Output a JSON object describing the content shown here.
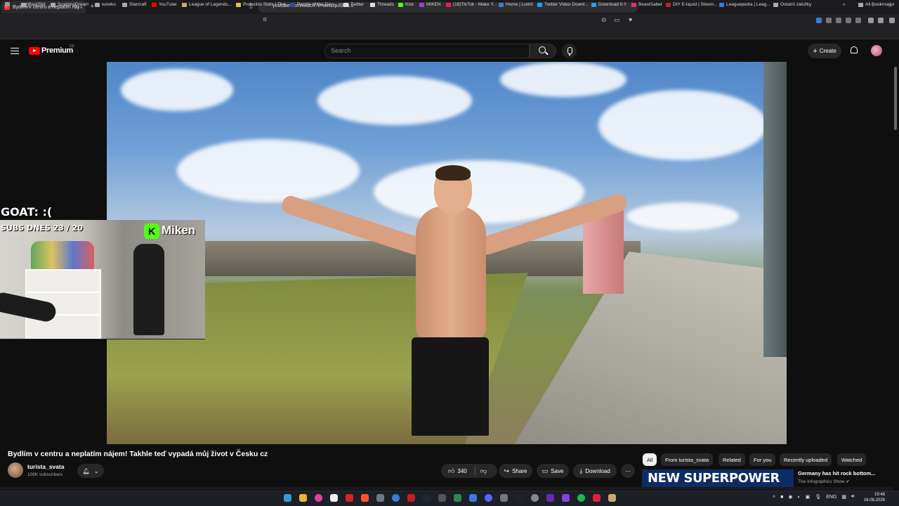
{
  "browser": {
    "tab_title": "Bydlím v centru a neplatím nájem",
    "tab_close": "×",
    "new_tab": "+",
    "url": "youtube.com/watch?v=weu3pJ0h3Ls",
    "bookmarks": [
      "RealShit",
      "ScalpingDream",
      "wowko",
      "Starcraft",
      "YouTube",
      "League of Legends...",
      "Probuilds Stats | The...",
      "Puzzle of the Day -...",
      "Twitter",
      "Threads",
      "Kick",
      "MIKEN",
      "(18)TikTok - Make Y...",
      "Home | Lurkit",
      "Twitter Video Downl...",
      "Download It !!",
      "BeastSaber",
      "DIY E-liquid | Steem...",
      "Leaguepedia | Leag...",
      "Ostatní záložky"
    ],
    "all_bookmarks": "All Bookmarks"
  },
  "youtube": {
    "logo": "Premium",
    "country": "CZ",
    "search_placeholder": "Search",
    "create_label": "Create",
    "create_plus": "+"
  },
  "overlay": {
    "goat_text": "GOAT: :(",
    "subs_text": "SUBS DNES 23 / 20",
    "badge_letter": "K",
    "streamer_name": "Miken"
  },
  "video": {
    "title": "Bydlím v centru a neplatím nájem! Takhle teď vypadá můj život v Česku cz",
    "channel": "turista_svata",
    "subscribers": "108K subscribers",
    "likes": "340",
    "share_label": "Share",
    "save_label": "Save",
    "download_label": "Download",
    "more_label": "⋯"
  },
  "chips": [
    "All",
    "From turista_svata",
    "Related",
    "For you",
    "Recently uploaded",
    "Watched"
  ],
  "suggestion": {
    "thumb_text": "NEW SUPERPOWER",
    "title": "Germany has hit rock bottom...",
    "channel": "The Infographics Show"
  },
  "taskbar": {
    "lang": "ENG",
    "time": "19:48",
    "date": "16.08.2026"
  },
  "colors": {
    "kick_green": "#53fc18",
    "youtube_red": "#ff0000",
    "background": "#0f0f0f"
  }
}
